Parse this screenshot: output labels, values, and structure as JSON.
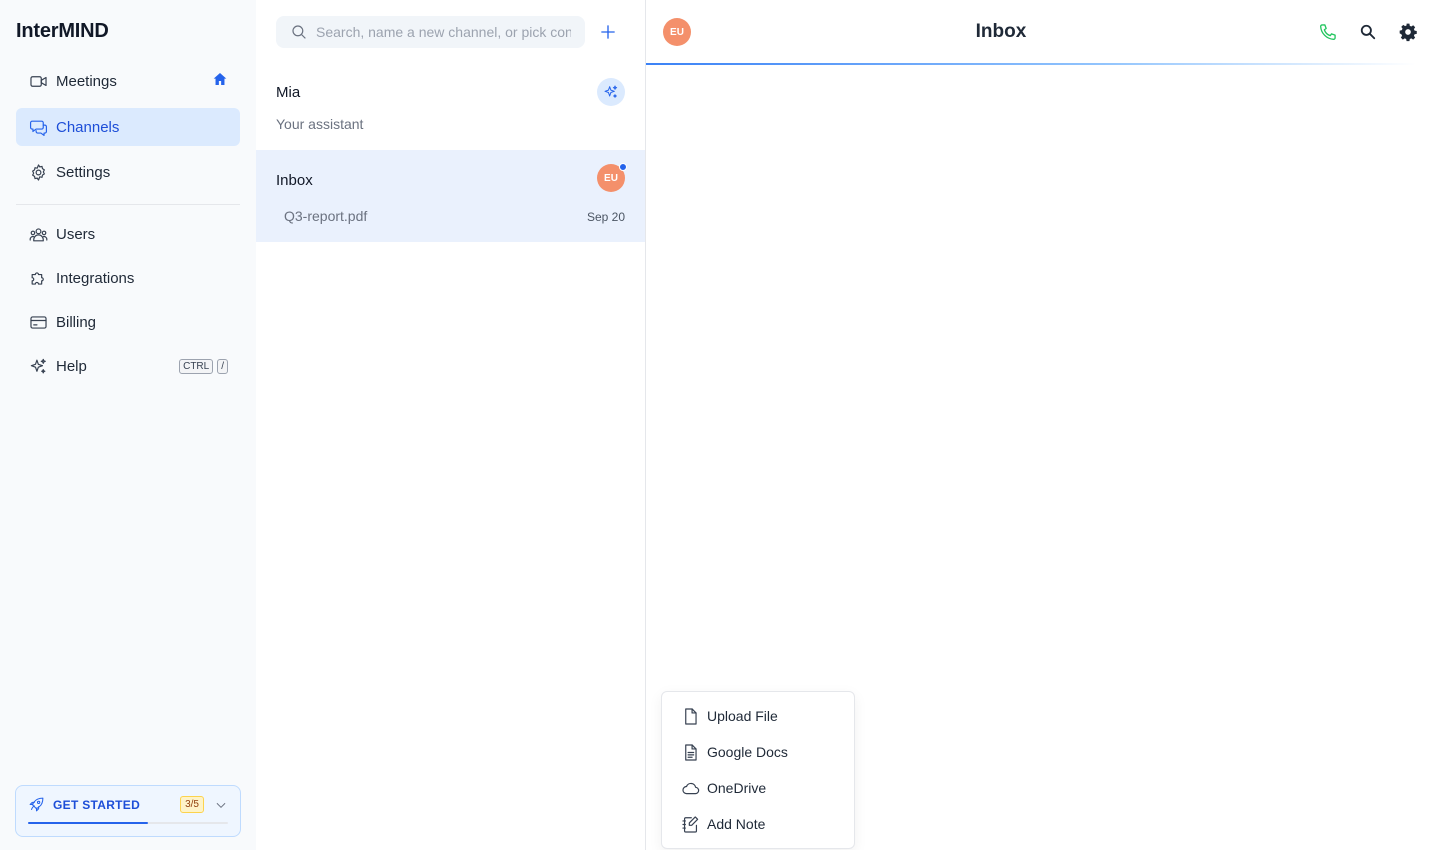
{
  "app": {
    "brand": "InterMIND"
  },
  "sidebar": {
    "items": [
      {
        "label": "Meetings"
      },
      {
        "label": "Channels"
      },
      {
        "label": "Settings"
      },
      {
        "label": "Users"
      },
      {
        "label": "Integrations"
      },
      {
        "label": "Billing"
      },
      {
        "label": "Help",
        "shortcut": [
          "CTRL",
          "/"
        ]
      }
    ],
    "get_started": {
      "label": "GET STARTED",
      "progress_text": "3/5",
      "progress": 0.6
    }
  },
  "channel_list": {
    "search_placeholder": "Search, name a new channel, or pick contact",
    "channels": [
      {
        "name": "Mia",
        "subtitle": "Your assistant"
      },
      {
        "name": "Inbox",
        "subtitle": "Q3-report.pdf",
        "date": "Sep 20",
        "avatar": "EU"
      }
    ]
  },
  "main": {
    "title": "Inbox",
    "avatar": "EU"
  },
  "attach_menu": {
    "items": [
      {
        "label": "Upload File"
      },
      {
        "label": "Google Docs"
      },
      {
        "label": "OneDrive"
      },
      {
        "label": "Add Note"
      }
    ]
  },
  "colors": {
    "accent": "#2563eb",
    "avatar": "#f4906b",
    "phone": "#22c55e",
    "active_bg": "#dbeafe"
  }
}
